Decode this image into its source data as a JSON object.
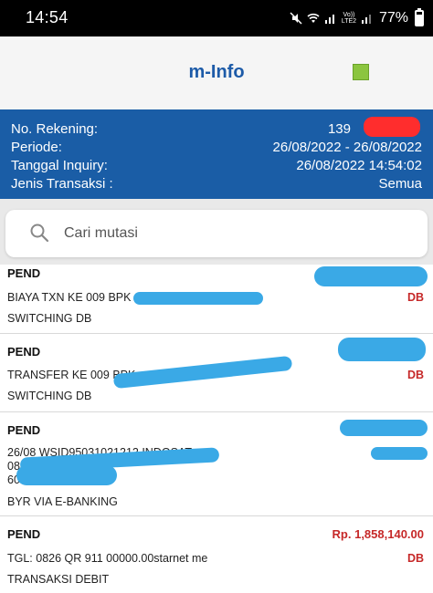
{
  "status_bar": {
    "time": "14:54",
    "volte": "Vo)) LTE2",
    "battery": "77%"
  },
  "app": {
    "title": "m-Info",
    "accent_color": "#1d5ba8",
    "status_indicator_color": "#8bc53f"
  },
  "info": {
    "rekening_label": "No. Rekening:",
    "rekening_value": "139",
    "periode_label": "Periode:",
    "periode_value": "26/08/2022 - 26/08/2022",
    "inquiry_label": "Tanggal Inquiry:",
    "inquiry_value": "26/08/2022 14:54:02",
    "jenis_label": "Jenis Transaksi :",
    "jenis_value": "Semua"
  },
  "search": {
    "placeholder": "Cari mutasi"
  },
  "transactions": [
    {
      "status": "PEND",
      "line1": "BIAYA TXN  KE 009 BPK",
      "line2": "SWITCHING DB",
      "type": "DB"
    },
    {
      "status": "PEND",
      "line1": "TRANSFER   KE 009 BPK",
      "line2": "SWITCHING DB",
      "type": "DB"
    },
    {
      "status": "PEND",
      "line1": "26/08  WSID95031021212 INDOSAT",
      "line2": "08",
      "line3": "60",
      "line4": "BYR VIA E-BANKING",
      "type": ""
    },
    {
      "status": "PEND",
      "amount": "Rp. 1,858,140.00",
      "line1": "TGL: 0826      QR  911        00000.00starnet me",
      "line2": "TRANSAKSI DEBIT",
      "type": "DB"
    }
  ]
}
